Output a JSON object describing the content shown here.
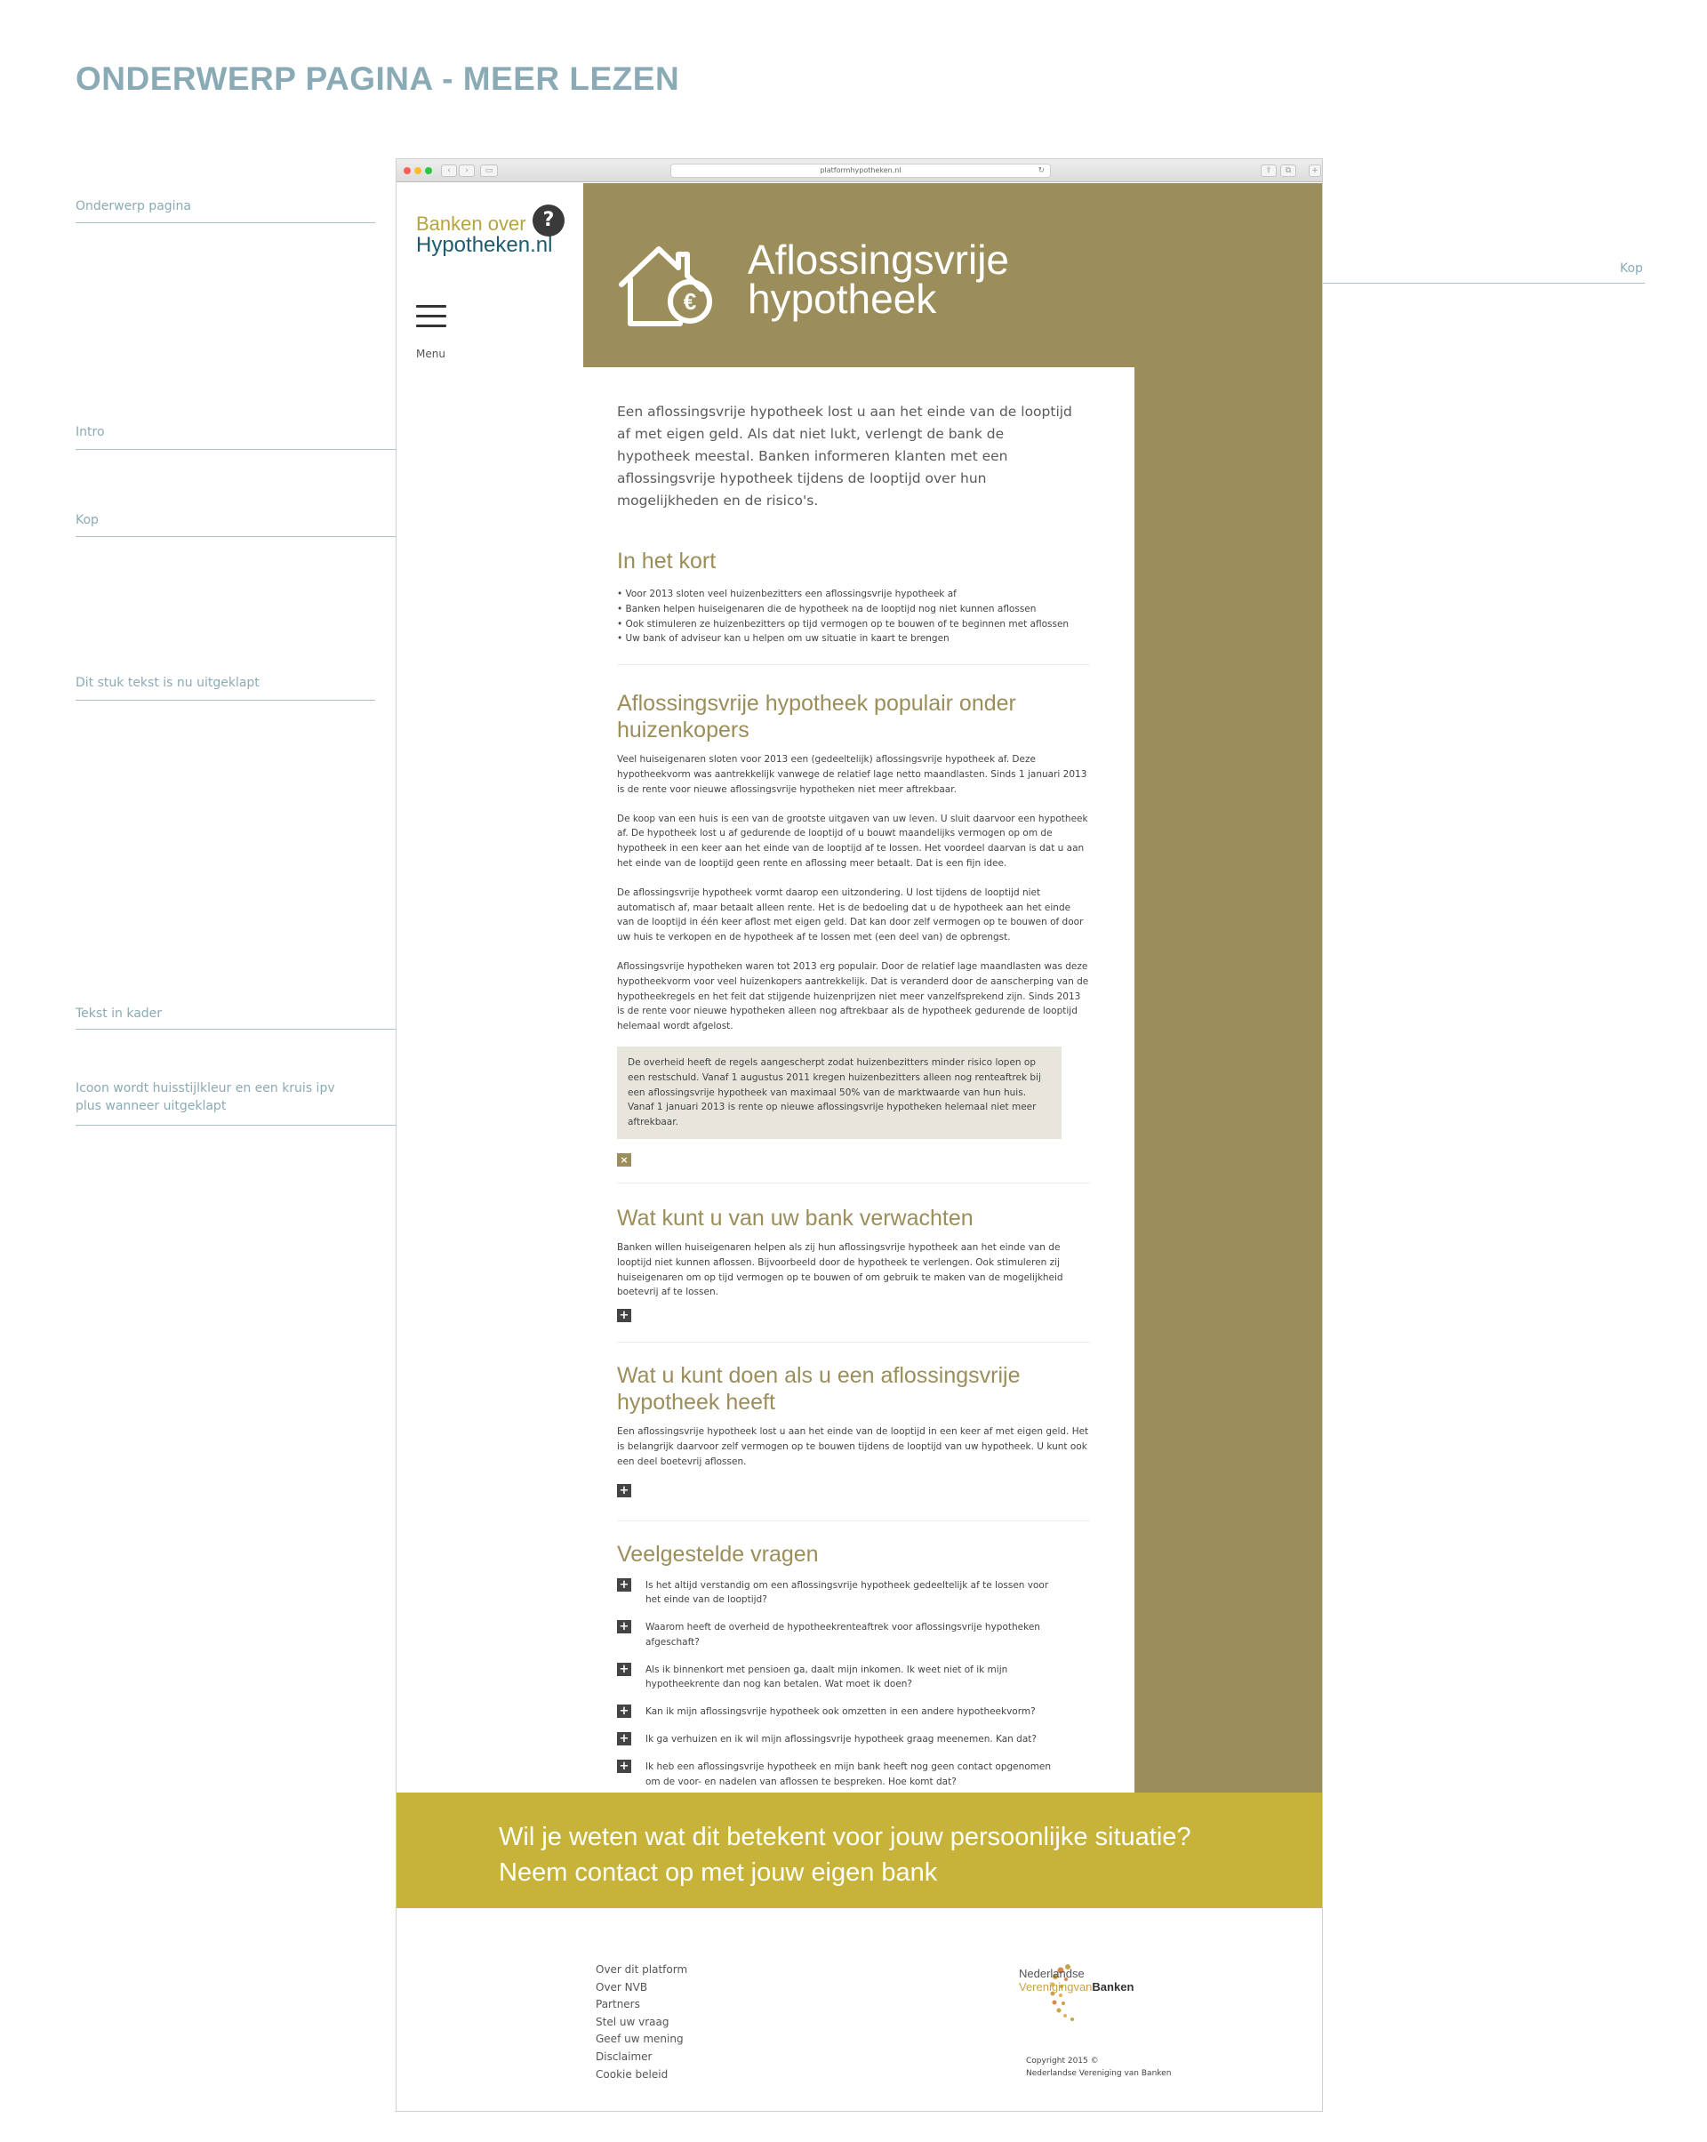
{
  "page_title": "ONDERWERP PAGINA - MEER LEZEN",
  "annotations": {
    "onderwerp_pagina": "Onderwerp pagina",
    "kop_right": "Kop",
    "intro": "Intro",
    "kop": "Kop",
    "uitgeklapt": "Dit stuk tekst is nu uitgeklapt",
    "tekst_in_kader": "Tekst in kader",
    "icoon_line1": "Icoon wordt huisstijlkleur en een kruis ipv",
    "icoon_line2": "plus wanneer uitgeklapt"
  },
  "browser": {
    "url": "platformhypotheken.nl",
    "back": "‹",
    "forward": "›",
    "sidebar_toggle": "▭",
    "reload": "↻",
    "share": "⇧",
    "tabs": "⧉",
    "new_tab": "+"
  },
  "site": {
    "logo_line1": "Banken over",
    "logo_line2": "Hypotheken.nl",
    "logo_q": "?",
    "menu_label": "Menu"
  },
  "hero": {
    "title_line1": "Aflossingsvrije",
    "title_line2": "hypotheek",
    "icon": "house-euro-icon"
  },
  "intro": "Een aflossingsvrije hypotheek lost u aan het einde van de looptijd af met eigen geld. Als dat niet lukt, verlengt de bank de hypotheek meestal. Banken informeren klanten met een aflossingsvrije hypotheek tijdens de looptijd over hun mogelijkheden en de risico's.",
  "in_het_kort": {
    "heading": "In het kort",
    "bullets": [
      "• Voor 2013 sloten veel huizenbezitters een aflossingsvrije hypotheek af",
      "• Banken helpen huiseigenaren die de hypotheek na de looptijd nog niet kunnen aflossen",
      "• Ook stimuleren ze huizenbezitters op tijd vermogen op te bouwen of te beginnen met aflossen",
      "• Uw bank of adviseur kan u helpen om uw situatie in kaart te brengen"
    ]
  },
  "section1": {
    "heading_line1": "Aflossingsvrije hypotheek populair onder",
    "heading_line2": "huizenkopers",
    "p1": "Veel huiseigenaren sloten voor 2013 een (gedeeltelijk) aflossingsvrije hypotheek af. Deze hypotheekvorm was aantrekkelijk vanwege de relatief lage netto maandlasten. Sinds 1 januari 2013 is de rente voor nieuwe aflossingsvrije hypotheken niet meer aftrekbaar.",
    "p2": "De koop van een huis is een van de grootste uitgaven van uw leven. U sluit daarvoor een hypotheek af. De hypotheek lost u af gedurende de looptijd of u bouwt maandelijks vermogen op om de hypotheek in een keer aan het einde van de looptijd af te lossen. Het voordeel daarvan is dat u aan het einde van de looptijd geen rente en aflossing meer betaalt. Dat is een fijn idee.",
    "p3": "De aflossingsvrije hypotheek vormt daarop een uitzondering. U lost tijdens de looptijd niet automatisch af, maar betaalt alleen rente. Het is de bedoeling dat u de hypotheek aan het einde van de looptijd in één keer aflost met eigen geld. Dat kan door zelf vermogen op te bouwen of door uw huis te verkopen en de hypotheek af te lossen met (een deel van) de opbrengst.",
    "p4": "Aflossingsvrije hypotheken waren tot 2013 erg populair. Door de relatief lage maandlasten was deze hypotheekvorm voor veel huizenkopers aantrekkelijk. Dat is veranderd door de aanscherping van de hypotheekregels en het feit dat stijgende huizenprijzen niet meer vanzelfsprekend zijn. Sinds 2013 is de rente voor nieuwe hypotheken alleen nog aftrekbaar als de hypotheek gedurende de looptijd helemaal wordt afgelost.",
    "box": "De overheid heeft de regels aangescherpt zodat huizenbezitters minder risico lopen op een restschuld. Vanaf 1 augustus 2011 kregen huizenbezitters alleen nog renteaftrek bij een aflossingsvrije hypotheek van maximaal 50% van de marktwaarde van hun huis. Vanaf 1 januari 2013 is rente op nieuwe aflossingsvrije hypotheken helemaal niet meer aftrekbaar.",
    "collapse_icon": "×"
  },
  "section2": {
    "heading": "Wat kunt u van uw bank verwachten",
    "p": "Banken willen huiseigenaren helpen als zij hun aflossingsvrije hypotheek aan het einde van de looptijd niet kunnen aflossen. Bijvoorbeeld door de hypotheek te verlengen. Ook stimuleren zij huiseigenaren om op tijd vermogen op te bouwen of om gebruik te maken van de mogelijkheid boetevrij af te lossen.",
    "expand_icon": "+"
  },
  "section3": {
    "heading_line1": "Wat u kunt doen als u een aflossingsvrije",
    "heading_line2": "hypotheek heeft",
    "p": "Een aflossingsvrije hypotheek lost u aan het einde van de looptijd in een keer af met eigen geld. Het is belangrijk daarvoor zelf vermogen op te bouwen tijdens de looptijd van uw hypotheek. U kunt ook een deel boetevrij aflossen.",
    "expand_icon": "+"
  },
  "faq": {
    "heading": "Veelgestelde vragen",
    "icon": "+",
    "items": [
      "Is het altijd verstandig om een aflossingsvrije hypotheek gedeeltelijk af te lossen voor het einde van de looptijd?",
      "Waarom heeft de overheid de hypotheekrenteaftrek voor aflossingsvrije hypotheken afgeschaft?",
      "Als ik binnenkort met pensioen ga, daalt mijn inkomen. Ik weet niet of ik mijn hypotheekrente dan nog kan betalen. Wat moet ik doen?",
      "Kan ik mijn aflossingsvrije hypotheek ook omzetten in een andere hypotheekvorm?",
      "Ik ga verhuizen en ik wil mijn aflossingsvrije hypotheek graag meenemen. Kan dat?",
      "Ik heb een aflossingsvrije hypotheek en mijn bank heeft nog geen contact opgenomen om de voor- en nadelen van aflossen te bespreken. Hoe komt dat?"
    ]
  },
  "cta": {
    "line1": "Wil je weten wat dit betekent voor jouw persoonlijke situatie?",
    "line2": "Neem contact op met jouw eigen bank"
  },
  "footer": {
    "links": [
      "Over dit platform",
      "Over NVB",
      "Partners",
      "Stel uw vraag",
      "Geef uw mening",
      "Disclaimer",
      "Cookie beleid"
    ],
    "nvb_line1": "Nederlandse",
    "nvb_line2a": "Vereniging",
    "nvb_line2b": "van",
    "nvb_line2c": "Banken",
    "copyright_line1": "Copyright 2015 ©",
    "copyright_line2": "Nederlandse Vereniging van Banken"
  },
  "colors": {
    "accent": "#9b8e5a",
    "cta": "#c7b33a",
    "annotation": "#8aabb5",
    "box": "#e7e5dc"
  }
}
